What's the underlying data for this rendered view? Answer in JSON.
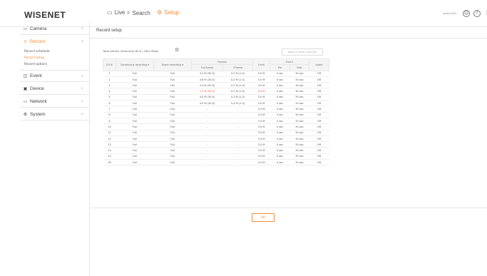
{
  "header": {
    "logo": "WISENET",
    "nav": [
      {
        "icon": "live-icon",
        "glyph": "▭",
        "label": "Live"
      },
      {
        "icon": "search-icon",
        "glyph": "⌕",
        "label": "Search"
      },
      {
        "icon": "setup-icon",
        "glyph": "⚙",
        "label": "Setup"
      }
    ],
    "user_id": "admin(ID)",
    "help_glyph": "?",
    "accent_color": "#f18c39"
  },
  "sidebar": {
    "menus": [
      {
        "label": "Camera",
        "icon": "camera-icon",
        "glyph": "▭",
        "arrow": "∨"
      },
      {
        "label": "Record",
        "icon": "record-icon",
        "glyph": "⊙",
        "arrow": "∧"
      },
      {
        "label": "Event",
        "icon": "event-icon",
        "glyph": "◫",
        "arrow": "∨"
      },
      {
        "label": "Device",
        "icon": "device-icon",
        "glyph": "▣",
        "arrow": "∨"
      },
      {
        "label": "Network",
        "icon": "network-icon",
        "glyph": "▭",
        "arrow": "∨"
      },
      {
        "label": "System",
        "icon": "system-icon",
        "glyph": "⚙",
        "arrow": "∨"
      }
    ],
    "record_sub": [
      "Record schedule",
      "Record setup",
      "Record options"
    ]
  },
  "main": {
    "title": "Record setup",
    "total_bitrate": "Total bitrate (Selected) 60.0 / 96.0 Mbps",
    "apply_label": "Apply to other channels",
    "ok_label": "OK",
    "table": {
      "headers": {
        "ch": "CH",
        "continuous": "Continuous recording",
        "event": "Event recording",
        "frames": "Frames",
        "full_frame": "Full frame",
        "iframe": "I-Frame",
        "limit": "Limit",
        "event_group": "Event",
        "pre": "Pre",
        "post": "Post",
        "audio": "Audio"
      },
      "rows": [
        [
          "1",
          "Full",
          "Full",
          "3.4 M (30.0)",
          "0.2 M (1.0)",
          "3.0 M",
          "5 sec",
          "30 sec",
          "Off"
        ],
        [
          "2",
          "Full",
          "Full",
          "3.8 M (30.0)",
          "0.2 M (1.0)",
          "3.0 M",
          "5 sec",
          "30 sec",
          "Off"
        ],
        [
          "3",
          "Full",
          "Full",
          "3.4 M (30.0)",
          "0.2 M (1.0)",
          "3.0 M",
          "5 sec",
          "30 sec",
          "Off"
        ],
        [
          "4",
          "Full",
          "Full",
          "7.2 M (30.0)",
          "0.3 M (1.0)",
          "4.0 M",
          "5 sec",
          "30 sec",
          "Off"
        ],
        [
          "5",
          "Full",
          "Full",
          "4.0 M (30.0)",
          "0.3 M (1.0)",
          "3.0 M",
          "5 sec",
          "30 sec",
          "Off"
        ],
        [
          "6",
          "Full",
          "Full",
          "4.0 M (30.0)",
          "0.4 M (1.0)",
          "3.0 M",
          "5 sec",
          "30 sec",
          "Off"
        ],
        [
          "7",
          "Full",
          "Full",
          "-",
          "-",
          "3.0 M",
          "5 sec",
          "30 sec",
          "Off"
        ],
        [
          "8",
          "Full",
          "Full",
          "-",
          "-",
          "3.0 M",
          "5 sec",
          "30 sec",
          "Off"
        ],
        [
          "9",
          "Full",
          "Full",
          "-",
          "-",
          "3.0 M",
          "5 sec",
          "30 sec",
          "Off"
        ],
        [
          "10",
          "Full",
          "Full",
          "-",
          "-",
          "3.0 M",
          "5 sec",
          "30 sec",
          "Off"
        ],
        [
          "11",
          "Full",
          "Full",
          "-",
          "-",
          "3.0 M",
          "5 sec",
          "30 sec",
          "Off"
        ],
        [
          "12",
          "Full",
          "Full",
          "-",
          "-",
          "3.0 M",
          "5 sec",
          "30 sec",
          "Off"
        ],
        [
          "13",
          "Full",
          "Full",
          "-",
          "-",
          "3.0 M",
          "5 sec",
          "30 sec",
          "Off"
        ],
        [
          "14",
          "Full",
          "Full",
          "-",
          "-",
          "3.0 M",
          "5 sec",
          "30 sec",
          "Off"
        ],
        [
          "15",
          "Full",
          "Full",
          "-",
          "-",
          "3.0 M",
          "5 sec",
          "30 sec",
          "Off"
        ],
        [
          "16",
          "Full",
          "Full",
          "-",
          "-",
          "3.0 M",
          "5 sec",
          "30 sec",
          "Off"
        ]
      ],
      "highlight_row_index": 3,
      "highlight_color": "#e8453c"
    }
  }
}
